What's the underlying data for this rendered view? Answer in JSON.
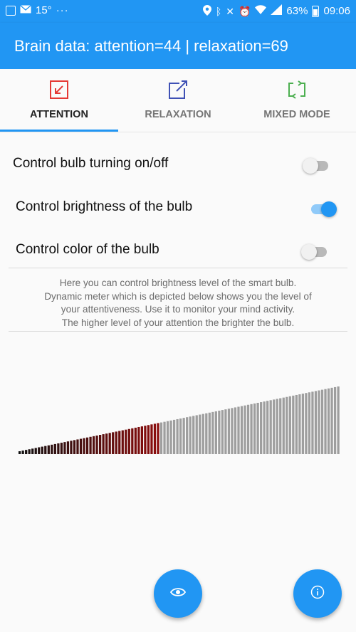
{
  "status_bar": {
    "temperature": "15°",
    "dots": "···",
    "battery": "63%",
    "time": "09:06"
  },
  "app_bar": {
    "title": "Brain data: attention=44 | relaxation=69"
  },
  "tabs": [
    {
      "label": "ATTENTION",
      "icon": "collapse-arrow-icon",
      "color": "#e53935",
      "active": true
    },
    {
      "label": "RELAXATION",
      "icon": "expand-arrow-icon",
      "color": "#3f51b5",
      "active": false
    },
    {
      "label": "MIXED MODE",
      "icon": "swap-arrows-icon",
      "color": "#4caf50",
      "active": false
    }
  ],
  "settings": [
    {
      "label": "Control bulb turning on/off",
      "on": false
    },
    {
      "label": "Control brightness of the bulb",
      "on": true
    },
    {
      "label": "Control color of the bulb",
      "on": false
    }
  ],
  "info_text": [
    "Here you can control brightness level of the smart bulb.",
    "Dynamic meter which is depicted below shows you the level of",
    "your attentiveness. Use it to monitor your mind activity.",
    "The higher level of your attention the brighter the bulb."
  ],
  "meter": {
    "level": 44,
    "max": 100,
    "colors": {
      "active_start": "#111111",
      "active_end": "#8b0d0d",
      "inactive": "#9e9e9e"
    }
  },
  "fabs": [
    {
      "icon": "eye-icon"
    },
    {
      "icon": "info-icon"
    }
  ],
  "colors": {
    "primary": "#2196f3"
  }
}
